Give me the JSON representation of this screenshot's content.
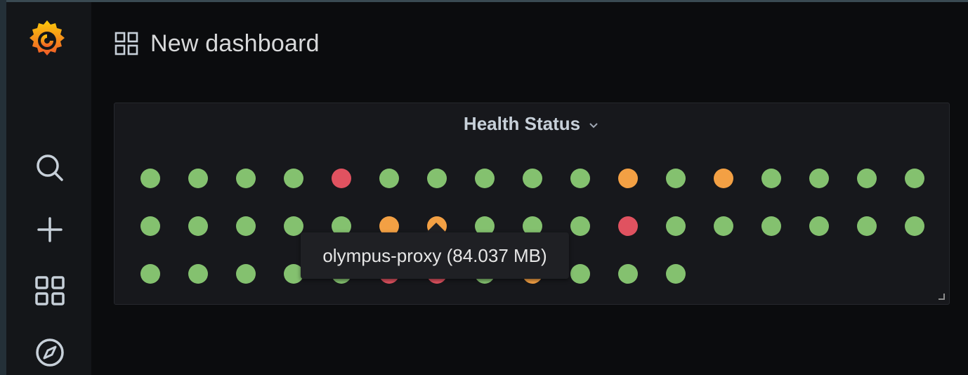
{
  "header": {
    "title": "New dashboard"
  },
  "sidebar": {
    "icons": [
      "grafana-logo",
      "search-icon",
      "plus-icon",
      "dashboards-icon",
      "explore-compass-icon"
    ]
  },
  "panel": {
    "title": "Health Status",
    "statuses": [
      "green",
      "green",
      "green",
      "green",
      "red",
      "green",
      "green",
      "green",
      "green",
      "green",
      "orange",
      "green",
      "orange",
      "green",
      "green",
      "green",
      "green",
      "green",
      "green",
      "green",
      "green",
      "green",
      "orange",
      "orange",
      "green",
      "green",
      "green",
      "red",
      "green",
      "green",
      "green",
      "green",
      "green",
      "green",
      "green",
      "green",
      "green",
      "green",
      "green",
      "red",
      "red",
      "green",
      "orange",
      "green",
      "green",
      "green"
    ],
    "columns": 17
  },
  "colors": {
    "green": "#84c16f",
    "orange": "#f3a044",
    "red": "#e05260"
  },
  "tooltip": {
    "text": "olympus-proxy (84.037 MB)"
  }
}
